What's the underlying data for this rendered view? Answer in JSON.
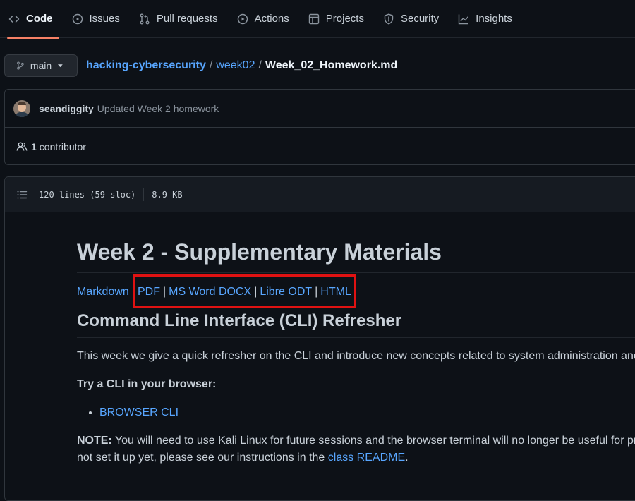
{
  "nav": {
    "items": [
      {
        "label": "Code",
        "icon": "code-icon",
        "active": true
      },
      {
        "label": "Issues",
        "icon": "issue-icon"
      },
      {
        "label": "Pull requests",
        "icon": "pull-request-icon"
      },
      {
        "label": "Actions",
        "icon": "play-icon"
      },
      {
        "label": "Projects",
        "icon": "table-icon"
      },
      {
        "label": "Security",
        "icon": "shield-icon"
      },
      {
        "label": "Insights",
        "icon": "graph-icon"
      }
    ]
  },
  "branch": {
    "label": "main"
  },
  "breadcrumb": {
    "repo": "hacking-cybersecurity",
    "sep1": "/",
    "folder": "week02",
    "sep2": "/",
    "file": "Week_02_Homework.md"
  },
  "commit": {
    "author": "seandiggity",
    "message": "Updated Week 2 homework"
  },
  "contributors": {
    "count": "1",
    "label": "contributor"
  },
  "file_info": {
    "lines": "120 lines (59 sloc)",
    "size": "8.9 KB"
  },
  "content": {
    "h1": "Week 2 - Supplementary Materials",
    "links": {
      "markdown": "Markdown",
      "pdf": "PDF",
      "docx": "MS Word DOCX",
      "odt": "Libre ODT",
      "html": "HTML",
      "pipe": "|"
    },
    "h2": "Command Line Interface (CLI) Refresher",
    "p1": "This week we give a quick refresher on the CLI and introduce new concepts related to system administration and",
    "p2": "Try a CLI in your browser:",
    "list_item": "BROWSER CLI",
    "note_label": "NOTE:",
    "note_text_1": " You will need to use Kali Linux for future sessions and the browser terminal will no longer be useful for pr",
    "note_text_2": "not set it up yet, please see our instructions in the ",
    "note_link": "class README",
    "note_end": "."
  },
  "colors": {
    "background": "#0d1117",
    "link": "#58a6ff",
    "active_underline": "#f78166",
    "highlight": "#e01212"
  }
}
